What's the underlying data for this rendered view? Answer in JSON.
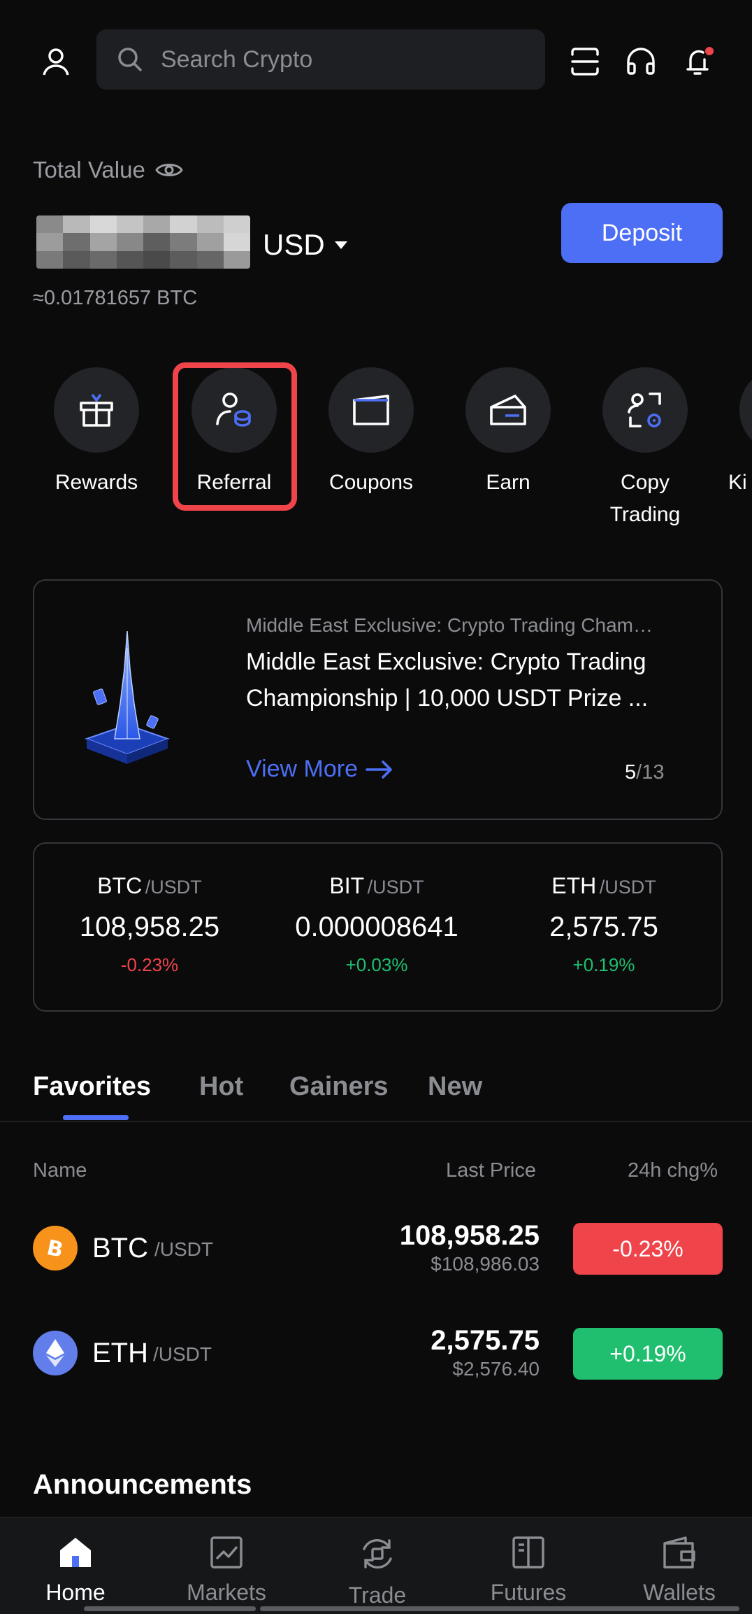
{
  "header": {
    "search_placeholder": "Search Crypto"
  },
  "portfolio": {
    "label": "Total Value",
    "currency": "USD",
    "btc_approx": "≈0.01781657 BTC",
    "deposit_label": "Deposit"
  },
  "quick_actions": [
    {
      "label": "Rewards",
      "icon": "gift-icon"
    },
    {
      "label": "Referral",
      "icon": "referral-icon",
      "highlighted": true
    },
    {
      "label": "Coupons",
      "icon": "coupon-icon"
    },
    {
      "label": "Earn",
      "icon": "earn-icon"
    },
    {
      "label": "Copy Trading",
      "icon": "copy-trading-icon"
    },
    {
      "label": "Ki",
      "icon": "kid-icon"
    }
  ],
  "banner": {
    "subtitle": "Middle East Exclusive: Crypto Trading Cham…",
    "title": "Middle East Exclusive: Crypto Trading Championship | 10,000 USDT Prize ...",
    "view_more": "View More",
    "page_current": "5",
    "page_total": "/13"
  },
  "tickers": [
    {
      "base": "BTC",
      "quote": "/USDT",
      "price": "108,958.25",
      "change": "-0.23%",
      "direction": "down"
    },
    {
      "base": "BIT",
      "quote": "/USDT",
      "price": "0.000008641",
      "change": "+0.03%",
      "direction": "up"
    },
    {
      "base": "ETH",
      "quote": "/USDT",
      "price": "2,575.75",
      "change": "+0.19%",
      "direction": "up"
    }
  ],
  "tabs": [
    {
      "label": "Favorites",
      "active": true
    },
    {
      "label": "Hot",
      "active": false
    },
    {
      "label": "Gainers",
      "active": false
    },
    {
      "label": "New",
      "active": false
    }
  ],
  "market": {
    "headers": {
      "name": "Name",
      "last_price": "Last Price",
      "change": "24h chg%"
    },
    "rows": [
      {
        "base": "BTC",
        "quote": "/USDT",
        "price": "108,958.25",
        "usd_price": "$108,986.03",
        "change": "-0.23%",
        "direction": "down",
        "icon": "bitcoin-icon"
      },
      {
        "base": "ETH",
        "quote": "/USDT",
        "price": "2,575.75",
        "usd_price": "$2,576.40",
        "change": "+0.19%",
        "direction": "up",
        "icon": "ethereum-icon"
      }
    ]
  },
  "announcements": {
    "title": "Announcements"
  },
  "bottom_nav": [
    {
      "label": "Home",
      "icon": "home-icon",
      "active": true
    },
    {
      "label": "Markets",
      "icon": "markets-icon",
      "active": false
    },
    {
      "label": "Trade",
      "icon": "trade-icon",
      "active": false
    },
    {
      "label": "Futures",
      "icon": "futures-icon",
      "active": false
    },
    {
      "label": "Wallets",
      "icon": "wallet-icon",
      "active": false
    }
  ],
  "colors": {
    "accent": "#4c6ff5",
    "negative": "#f0444b",
    "positive": "#1fbf6f",
    "highlight_border": "#f0444b",
    "bitcoin": "#f7931a",
    "ethereum": "#627eea"
  }
}
